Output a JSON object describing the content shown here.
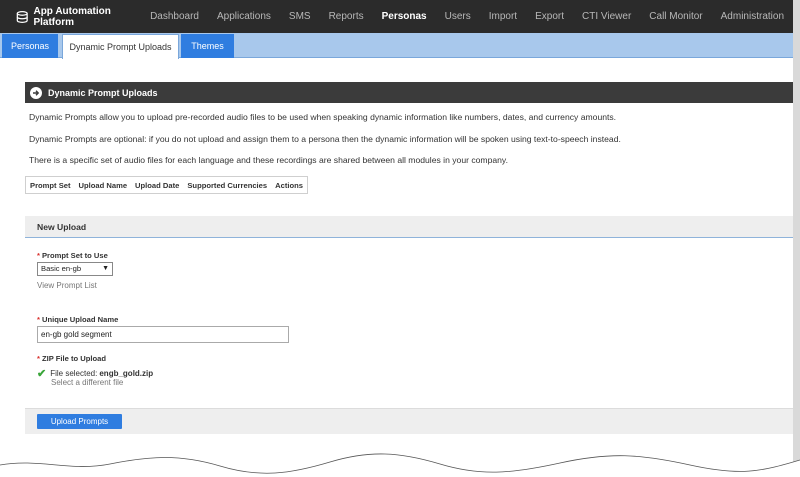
{
  "app": {
    "title": "App Automation Platform"
  },
  "nav": {
    "items": [
      "Dashboard",
      "Applications",
      "SMS",
      "Reports",
      "Personas",
      "Users",
      "Import",
      "Export",
      "CTI Viewer",
      "Call Monitor",
      "Administration"
    ],
    "active": "Personas"
  },
  "subtabs": [
    "Personas",
    "Dynamic Prompt Uploads",
    "Themes"
  ],
  "section": {
    "title": "Dynamic Prompt Uploads",
    "paragraphs": [
      "Dynamic Prompts allow you to upload pre-recorded audio files to be used when speaking dynamic information like numbers, dates, and currency amounts.",
      "Dynamic Prompts are optional: if you do not upload and assign them to a persona then the dynamic information will be spoken using text-to-speech instead.",
      "There is a specific set of audio files for each language and these recordings are shared between all modules in your company."
    ],
    "table_headers": [
      "Prompt Set",
      "Upload Name",
      "Upload Date",
      "Supported Currencies",
      "Actions"
    ]
  },
  "new_upload": {
    "title": "New Upload",
    "prompt_set_label": "Prompt Set to Use",
    "prompt_set_value": "Basic en-gb",
    "view_prompt_list": "View Prompt List",
    "upload_name_label": "Unique Upload Name",
    "upload_name_value": "en-gb gold segment",
    "zip_label": "ZIP File to Upload",
    "file_selected_prefix": "File selected:",
    "file_name": "engb_gold.zip",
    "select_different": "Select a different file",
    "upload_button": "Upload Prompts"
  },
  "colors": {
    "nav_bg": "#2b2b2b",
    "accent": "#2f7de0",
    "subbar": "#a8c8ec",
    "required": "#d9302c",
    "check": "#3aa53a"
  }
}
